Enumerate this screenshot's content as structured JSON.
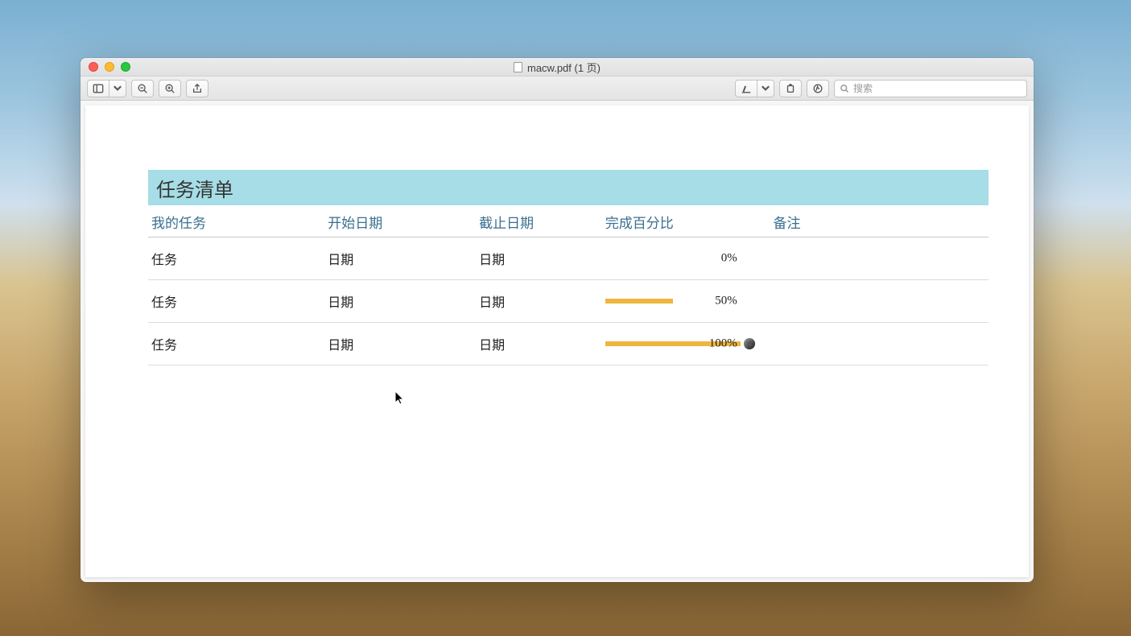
{
  "window": {
    "title": "macw.pdf  (1 页)"
  },
  "search": {
    "placeholder": "搜索"
  },
  "document": {
    "title": "任务清单",
    "columns": [
      "我的任务",
      "开始日期",
      "截止日期",
      "完成百分比",
      "备注"
    ],
    "rows": [
      {
        "task": "任务",
        "start": "日期",
        "end": "日期",
        "pct": 0,
        "pct_label": "0%",
        "note": "",
        "show_dot": false
      },
      {
        "task": "任务",
        "start": "日期",
        "end": "日期",
        "pct": 50,
        "pct_label": "50%",
        "note": "",
        "show_dot": false
      },
      {
        "task": "任务",
        "start": "日期",
        "end": "日期",
        "pct": 100,
        "pct_label": "100%",
        "note": "",
        "show_dot": true
      }
    ]
  },
  "colors": {
    "header_bg": "#a6dde6",
    "bar": "#eeb63f",
    "col_header": "#3a6f8f"
  }
}
